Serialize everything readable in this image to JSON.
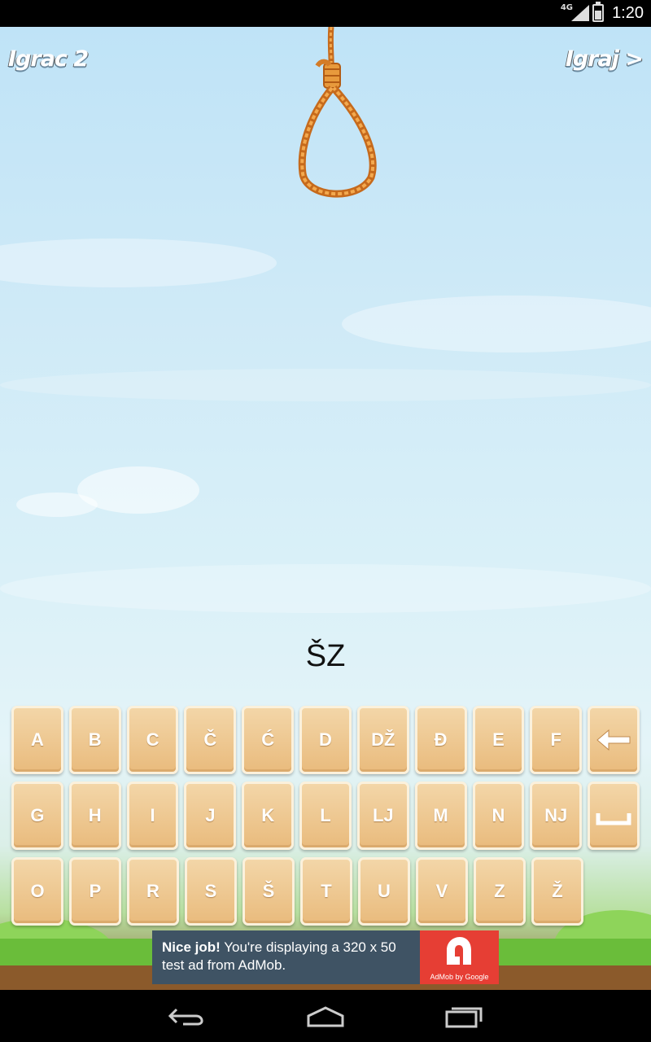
{
  "status_bar": {
    "network": "4G",
    "time": "1:20"
  },
  "header": {
    "player_label": "Igrac 2",
    "play_link": "Igraj >"
  },
  "game": {
    "guess_word": "ŠZ"
  },
  "keyboard": {
    "rows": [
      [
        "A",
        "B",
        "C",
        "Č",
        "Ć",
        "D",
        "DŽ",
        "Đ",
        "E",
        "F"
      ],
      [
        "G",
        "H",
        "I",
        "J",
        "K",
        "L",
        "LJ",
        "M",
        "N",
        "NJ"
      ],
      [
        "O",
        "P",
        "R",
        "S",
        "Š",
        "T",
        "U",
        "V",
        "Z",
        "Ž"
      ]
    ],
    "backspace_icon": "arrow-left-icon",
    "space_icon": "space-bar-icon"
  },
  "ad": {
    "headline": "Nice job!",
    "body": "You're displaying a 320 x 50 test ad from AdMob.",
    "logo_caption": "AdMob by Google",
    "logo_color": "#e63e34",
    "background_color": "#3f5364"
  },
  "nav_bar": {
    "back_icon": "back-icon",
    "home_icon": "home-icon",
    "recents_icon": "recents-icon"
  }
}
